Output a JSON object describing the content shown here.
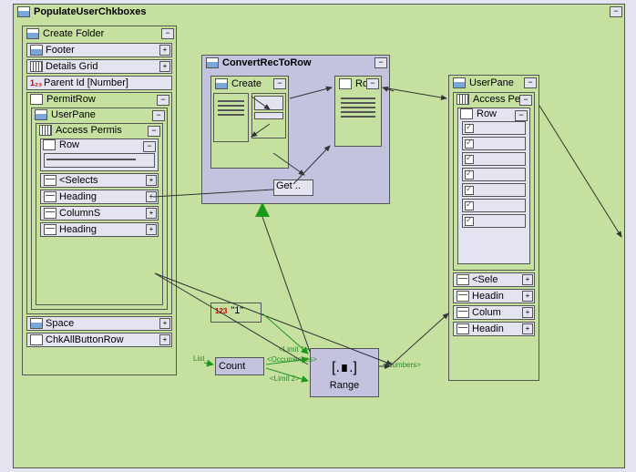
{
  "root": {
    "title": "PopulateUserChkboxes"
  },
  "createFolder": {
    "title": "Create Folder",
    "items": {
      "footer": "Footer",
      "detailsGrid": "Details Grid",
      "parentId": "Parent Id [Number]",
      "permitRow": "PermitRow",
      "userPane": "UserPane",
      "accessPerm": "Access Permis",
      "row": "Row",
      "selects": "<Selects",
      "heading1": "Heading",
      "columns": "ColumnS",
      "heading2": "Heading",
      "space": "Space",
      "chkAll": "ChkAllButtonRow"
    }
  },
  "convert": {
    "title": "ConvertRecToRow",
    "create": "Create",
    "row": "Row",
    "get": "Get .."
  },
  "userPane2": {
    "title": "UserPane",
    "accessPerm": "Access Perm",
    "row": "Row",
    "selects": "<Sele",
    "heading1": "Headin",
    "columns": "Colum",
    "heading2": "Headin"
  },
  "literal1": {
    "value": "\"1\""
  },
  "count": {
    "label": "Count"
  },
  "range": {
    "label": "Range"
  },
  "ports": {
    "list": "List",
    "occurrences": "<Occurrences>",
    "limit1": "<Limit 1>",
    "limit2": "<Limit 2>",
    "numbers": "<Numbers>"
  }
}
